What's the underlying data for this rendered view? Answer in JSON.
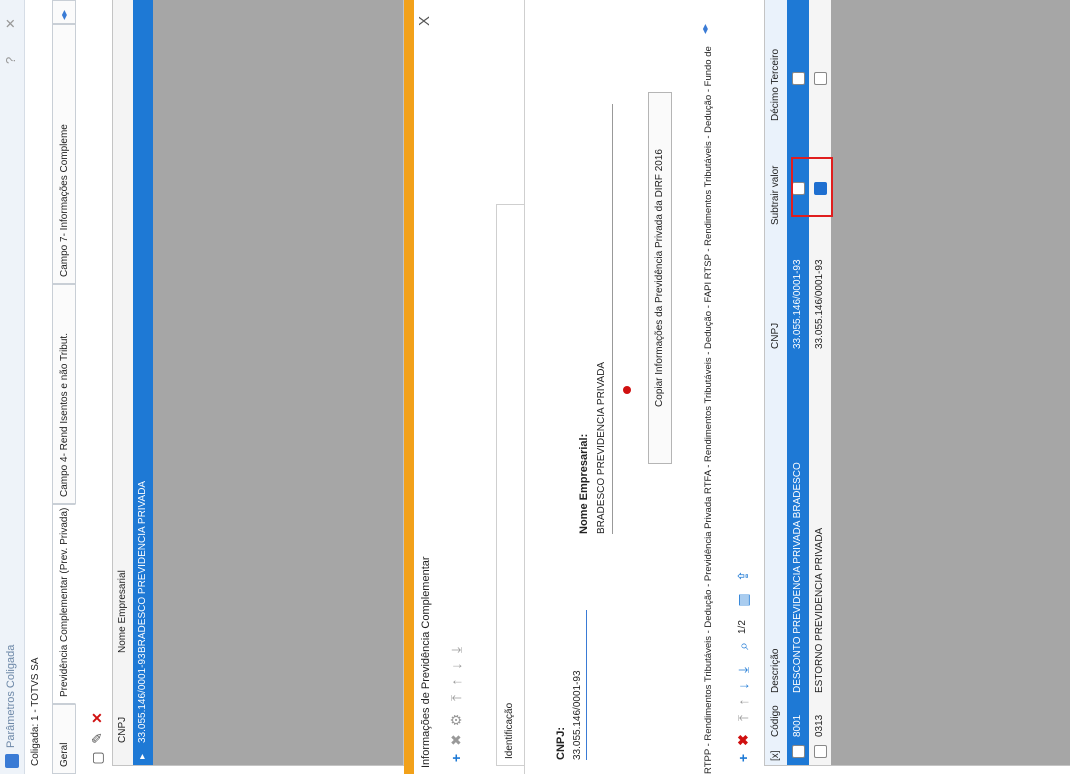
{
  "window": {
    "title": "Parâmetros Coligada"
  },
  "coligada": "Coligada: 1 - TOTVS SA",
  "tabs": [
    "Geral",
    "Previdência Complementar (Prev. Privada)",
    "Campo 4- Rend Isentos e não Tribut.",
    "Campo 7- Informações Compleme"
  ],
  "grid1": {
    "headers": [
      "CNPJ",
      "Nome Empresarial"
    ],
    "rows": [
      {
        "cnpj": "33.055.146/0001-93",
        "nome": "BRADESCO PREVIDENCIA PRIVADA"
      }
    ]
  },
  "modal": {
    "title": "Informações de Previdência Complementar",
    "close": "X",
    "section": "Identificação",
    "cnpj_label": "CNPJ:",
    "cnpj_value": "33.055.146/0001-93",
    "nome_label": "Nome Empresarial:",
    "nome_value": "BRADESCO PREVIDENCIA PRIVADA",
    "copy_button": "Copiar Informações da Previdência Privada da DIRF 2016",
    "subtabs": "RTPP - Rendimentos Tributáveis - Dedução - Previdência Privada   RTFA - Rendimentos Tributáveis - Dedução - FAPI   RTSP - Rendimentos Tributáveis - Dedução - Fundo de"
  },
  "toolbar": {
    "page": "1/2"
  },
  "grid2": {
    "headers": [
      "[x]",
      "Código",
      "Descrição",
      "CNPJ",
      "Subtrair valor",
      "Décimo Terceiro"
    ],
    "rows": [
      {
        "codigo": "8001",
        "descricao": "DESCONTO PREVIDENCIA PRIVADA BRADESCO",
        "cnpj": "33.055.146/0001-93"
      },
      {
        "codigo": "0313",
        "descricao": "ESTORNO PREVIDENCIA PRIVADA",
        "cnpj": "33.055.146/0001-93"
      }
    ]
  },
  "colors": {
    "accent": "#1e79d5",
    "orange": "#f2a11a",
    "highlight": "#e01e1e",
    "grid_bg": "#a6a6a6"
  },
  "icons": [
    "app-icon",
    "new-icon",
    "edit-icon",
    "delete-icon",
    "add-icon",
    "settings-icon",
    "move-top-icon",
    "move-up-icon",
    "move-down-icon",
    "move-bottom-icon",
    "search-icon",
    "columns-icon",
    "export-icon"
  ]
}
